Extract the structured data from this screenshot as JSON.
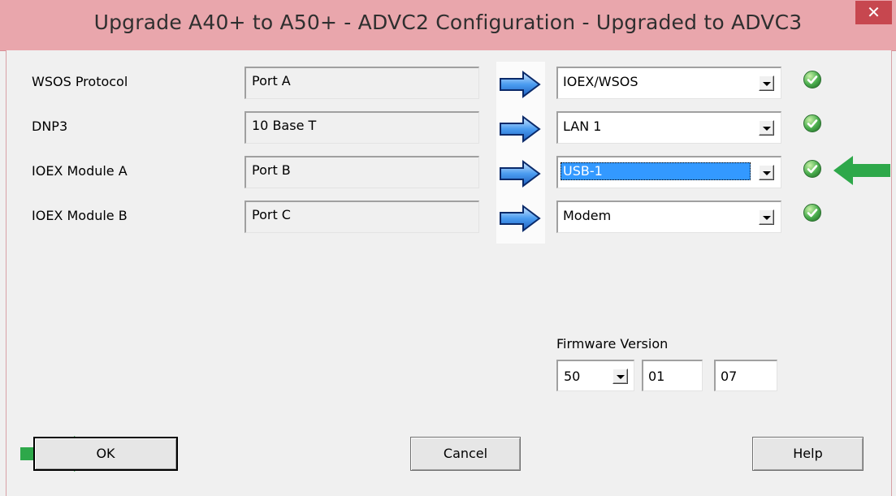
{
  "window": {
    "title": "Upgrade A40+ to A50+ - ADVC2 Configuration - Upgraded to ADVC3",
    "close_glyph": "✕"
  },
  "rows": [
    {
      "label": "WSOS Protocol",
      "source": "Port A",
      "target": "IOEX/WSOS",
      "status": "check-icon"
    },
    {
      "label": "DNP3",
      "source": "10 Base T",
      "target": "LAN 1",
      "status": "check-icon"
    },
    {
      "label": "IOEX Module A",
      "source": "Port B",
      "target": "USB-1",
      "status": "check-icon",
      "selected": true
    },
    {
      "label": "IOEX Module B",
      "source": "Port C",
      "target": "Modem",
      "status": "check-icon"
    }
  ],
  "firmware": {
    "label": "Firmware Version",
    "major": "50",
    "minor": "01",
    "patch": "07"
  },
  "buttons": {
    "ok": "OK",
    "cancel": "Cancel",
    "help": "Help"
  },
  "colors": {
    "title_bar": "#e9a6ac",
    "close_button": "#c7474f",
    "selection": "#3399ff",
    "annotation_arrow": "#2ea84a",
    "check": "#4caf50"
  }
}
